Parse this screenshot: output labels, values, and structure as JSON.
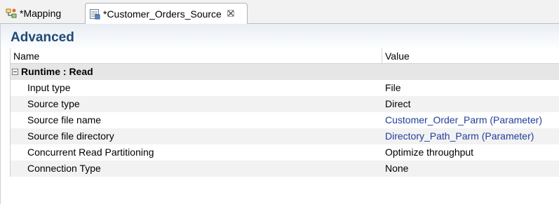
{
  "tabs": [
    {
      "label": "*Mapping",
      "icon": "mapping-icon",
      "active": false
    },
    {
      "label": "*Customer_Orders_Source",
      "icon": "data-object-icon",
      "active": true,
      "close_icon": "close-icon"
    }
  ],
  "section": {
    "title": "Advanced"
  },
  "table": {
    "columns": [
      "Name",
      "Value"
    ],
    "group": {
      "label": "Runtime : Read",
      "toggle": "collapse-icon"
    },
    "rows": [
      {
        "name": "Input type",
        "value": "File"
      },
      {
        "name": "Source type",
        "value": "Direct"
      },
      {
        "name": "Source file name",
        "value": "Customer_Order_Parm (Parameter)"
      },
      {
        "name": "Source file directory",
        "value": "Directory_Path_Parm (Parameter)"
      },
      {
        "name": "Concurrent Read Partitioning",
        "value": "Optimize throughput"
      },
      {
        "name": "Connection Type",
        "value": "None"
      }
    ]
  },
  "colors": {
    "title": "#204a75",
    "parameter_value": "#1f3f9c"
  }
}
